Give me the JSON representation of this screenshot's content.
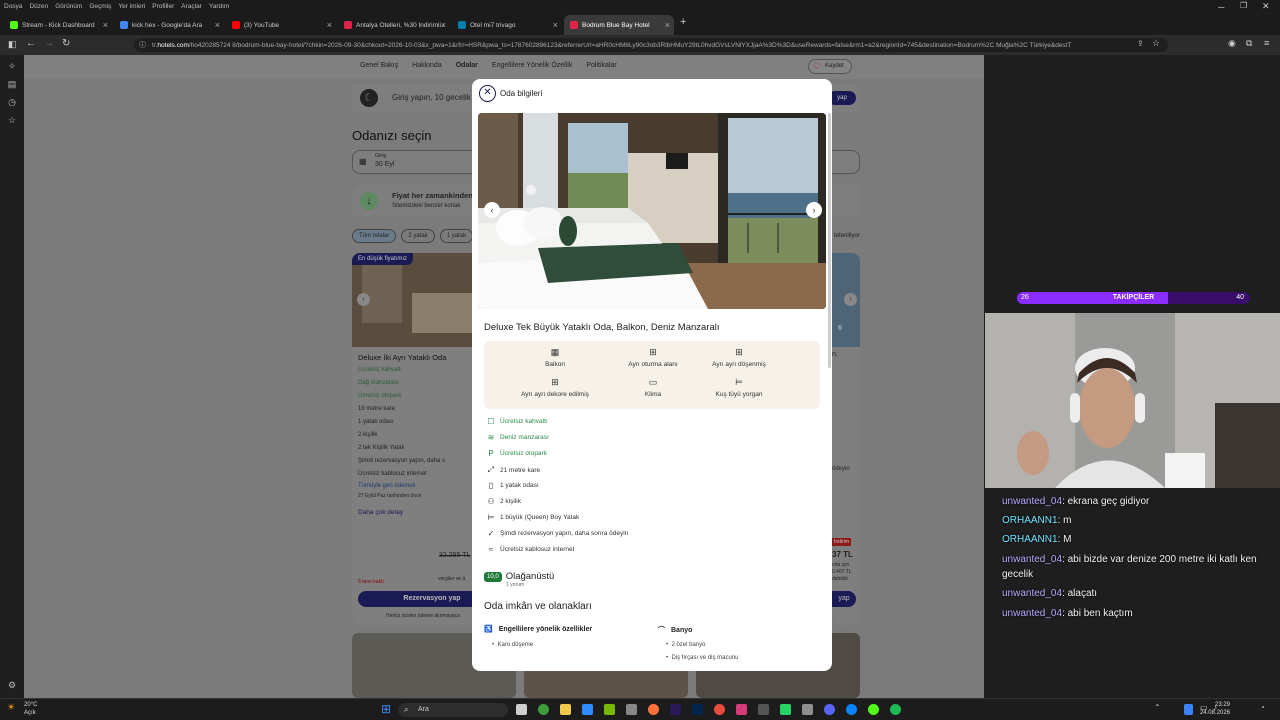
{
  "browser": {
    "menu": [
      "Dosya",
      "Düzen",
      "Görünüm",
      "Geçmiş",
      "Yer imleri",
      "Profiller",
      "Araçlar",
      "Yardım"
    ],
    "tabs": [
      {
        "label": "Stream - Kick Dashboard",
        "color": "#53fc18"
      },
      {
        "label": "kick hex - Google'da Ara",
        "color": "#4285f4"
      },
      {
        "label": "(3) YouTube",
        "color": "#ff0000"
      },
      {
        "label": "Antalya Otelleri, %30 İndirimli A",
        "color": "#e1234c"
      },
      {
        "label": "Otel mi7 trivago",
        "color": "#007fad"
      },
      {
        "label": "Bodrum Blue Bay Hotel",
        "color": "#e1234c"
      }
    ],
    "new_tab": "+",
    "url_prefix": "tr.",
    "url_host": "hotels.com",
    "url_rest": "/ho420285724 8/bodrum-blue-bay-hotel/?chkin=2026-09-30&chkout=2026-10-03&x_pwa=1&rfrr=HSR&pwa_ts=1787602896123&referrerUrl=aHR0cHM6Ly90c3ob3RlbHMuY29tL0hvdGVsLVNlYXJjaA%3D%3D&useRewards=false&rm1=a2&regionId=745&destination=Bodrum%2C Muğla%2C Türkiye&destT"
  },
  "page": {
    "nav": [
      "Genel Bakış",
      "Hakkında",
      "Odalar",
      "Engellilere Yönelik Özellik",
      "Politikalar"
    ],
    "save_label": "Kaydet",
    "signin_text": "Giriş yapın, 10 gecelik",
    "signin_button": "yap",
    "heading": "Odanızı seçin",
    "checkin_label": "Giriş",
    "checkin_value": "30 Eyl",
    "price_info_title": "Fiyat her zamankinden",
    "price_info_sub": "Sitemizdeki benzer konak",
    "filters": [
      "Tüm odalar",
      "2 yatak",
      "1 yatak"
    ],
    "right_filter": "teteniliyor",
    "card1": {
      "badge": "En düşük fiyatımız",
      "title": "Deluxe İki Ayrı Yataklı Oda",
      "features": [
        "Ücretsiz kahvaltı",
        "Dağ manzarası",
        "Ücretsiz otopark",
        "19 metre kare",
        "1 yatak odası",
        "2 kişilik",
        "2 tek Kişilik Yatak",
        "Şimdi rezervasyon yapın, daha s",
        "Ücretsiz kablosuz internet"
      ],
      "refund": "Tümüyle geri ödemeli",
      "refund_sub": "27 Eylül Paz tarihinden önce",
      "details": "Daha çok detay",
      "old_price": "32.255 TL",
      "left_note": "5 tane kaldı",
      "tax_note": "vergiler ve ü",
      "reserve": "Rezervasyon yap",
      "no_charge": "Henüz sizden ödeme alınmayaca"
    },
    "card3": {
      "title": "n,",
      "price": "37 TL",
      "badge": "İndirim",
      "note1": "oda için",
      "note2": "0.407 TL",
      "note3": "dahildir",
      "pay": "ödeyin",
      "reserve": "yap",
      "photo_count": "6"
    }
  },
  "modal": {
    "title": "Oda bilgileri",
    "room_title": "Deluxe Tek Büyük Yataklı Oda, Balkon, Deniz Manzaralı",
    "amenities": [
      {
        "icon": "balcony-icon",
        "glyph": "▦",
        "label": "Balkon"
      },
      {
        "icon": "sofa-icon",
        "glyph": "⊞",
        "label": "Ayrı oturma alanı"
      },
      {
        "icon": "furnished-icon",
        "glyph": "⊞",
        "label": "Ayrı ayrı döşenmiş"
      },
      {
        "icon": "decor-icon",
        "glyph": "⊞",
        "label": "Ayrı ayrı dekore edilmiş"
      },
      {
        "icon": "ac-icon",
        "glyph": "▭",
        "label": "Klima"
      },
      {
        "icon": "duvet-icon",
        "glyph": "⊨",
        "label": "Kuş tüyü yorgan"
      }
    ],
    "features": [
      {
        "icon": "breakfast-icon",
        "glyph": "☐",
        "label": "Ücretsiz kahvaltı",
        "green": true
      },
      {
        "icon": "sea-view-icon",
        "glyph": "≋",
        "label": "Deniz manzarası",
        "green": true
      },
      {
        "icon": "parking-icon",
        "glyph": "P",
        "label": "Ücretsiz otopark",
        "green": true
      },
      {
        "icon": "size-icon",
        "glyph": "⤢",
        "label": "21 metre kare",
        "green": false
      },
      {
        "icon": "door-icon",
        "glyph": "▯",
        "label": "1 yatak odası",
        "green": false
      },
      {
        "icon": "people-icon",
        "glyph": "⚇",
        "label": "2 kişilik",
        "green": false
      },
      {
        "icon": "bed-icon",
        "glyph": "⊨",
        "label": "1 büyük (Queen) Boy Yatak",
        "green": false
      },
      {
        "icon": "check-icon",
        "glyph": "✓",
        "label": "Şimdi rezervasyon yapın, daha sonra ödeyin",
        "green": false
      },
      {
        "icon": "wifi-icon",
        "glyph": "≈",
        "label": "Ücretsiz kablosuz internet",
        "green": false
      }
    ],
    "rating_score": "10,0",
    "rating_word": "Olağanüstü",
    "reviews": "1 yorum",
    "facilities_title": "Oda imkân ve olanakları",
    "accessibility_title": "Engellilere yönelik özellikler",
    "accessibility_items": [
      "Karo döşeme"
    ],
    "bathroom_title": "Banyo",
    "bathroom_items": [
      "2 özel banyo",
      "Diş fırçası ve diş macunu"
    ]
  },
  "stream": {
    "followers_label": "TAKİPÇİLER",
    "followers_current": "26",
    "followers_goal": "40",
    "followers_fraction": 0.65,
    "chat": [
      {
        "user": "unwanted_04",
        "text": ": ekrana geç gidiyor"
      },
      {
        "user": "ORHAANN1",
        "text": ": m"
      },
      {
        "user": "ORHAANN1",
        "text": ": M"
      },
      {
        "user": "unwanted_04",
        "text": ": abi bizde var denize 200 metre iki katlı ken gecelik"
      },
      {
        "user": "unwanted_04",
        "text": ": alaçatı"
      },
      {
        "user": "unwanted_04",
        "text": ": abi ben kaçtım"
      }
    ]
  },
  "taskbar": {
    "temp": "20°C",
    "weather": "Açık",
    "search": "Ara",
    "time": "23:29",
    "date": "24.08.2026"
  }
}
